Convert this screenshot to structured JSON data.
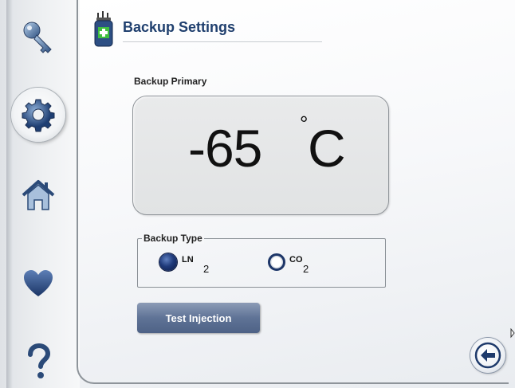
{
  "header": {
    "title": "Backup Settings",
    "icon": "cylinder-plus-icon"
  },
  "sidebar": {
    "items": [
      {
        "name": "key-icon",
        "active": false
      },
      {
        "name": "gear-icon",
        "active": true
      },
      {
        "name": "home-icon",
        "active": false
      },
      {
        "name": "heart-icon",
        "active": false
      },
      {
        "name": "question-icon",
        "active": false
      }
    ]
  },
  "primary": {
    "label": "Backup Primary",
    "temperature": "-65",
    "degree_symbol": "°",
    "unit": "C"
  },
  "backup_type": {
    "legend": "Backup Type",
    "options": [
      {
        "base": "LN",
        "subscript": "2",
        "selected": true
      },
      {
        "base": "CO",
        "subscript": "2",
        "selected": false
      }
    ]
  },
  "actions": {
    "test_injection_label": "Test Injection",
    "back_icon": "back-arrow-icon"
  },
  "colors": {
    "title": "#1f3f6e",
    "button": "#5f7396",
    "radio_selected": "#1f3a7a"
  }
}
